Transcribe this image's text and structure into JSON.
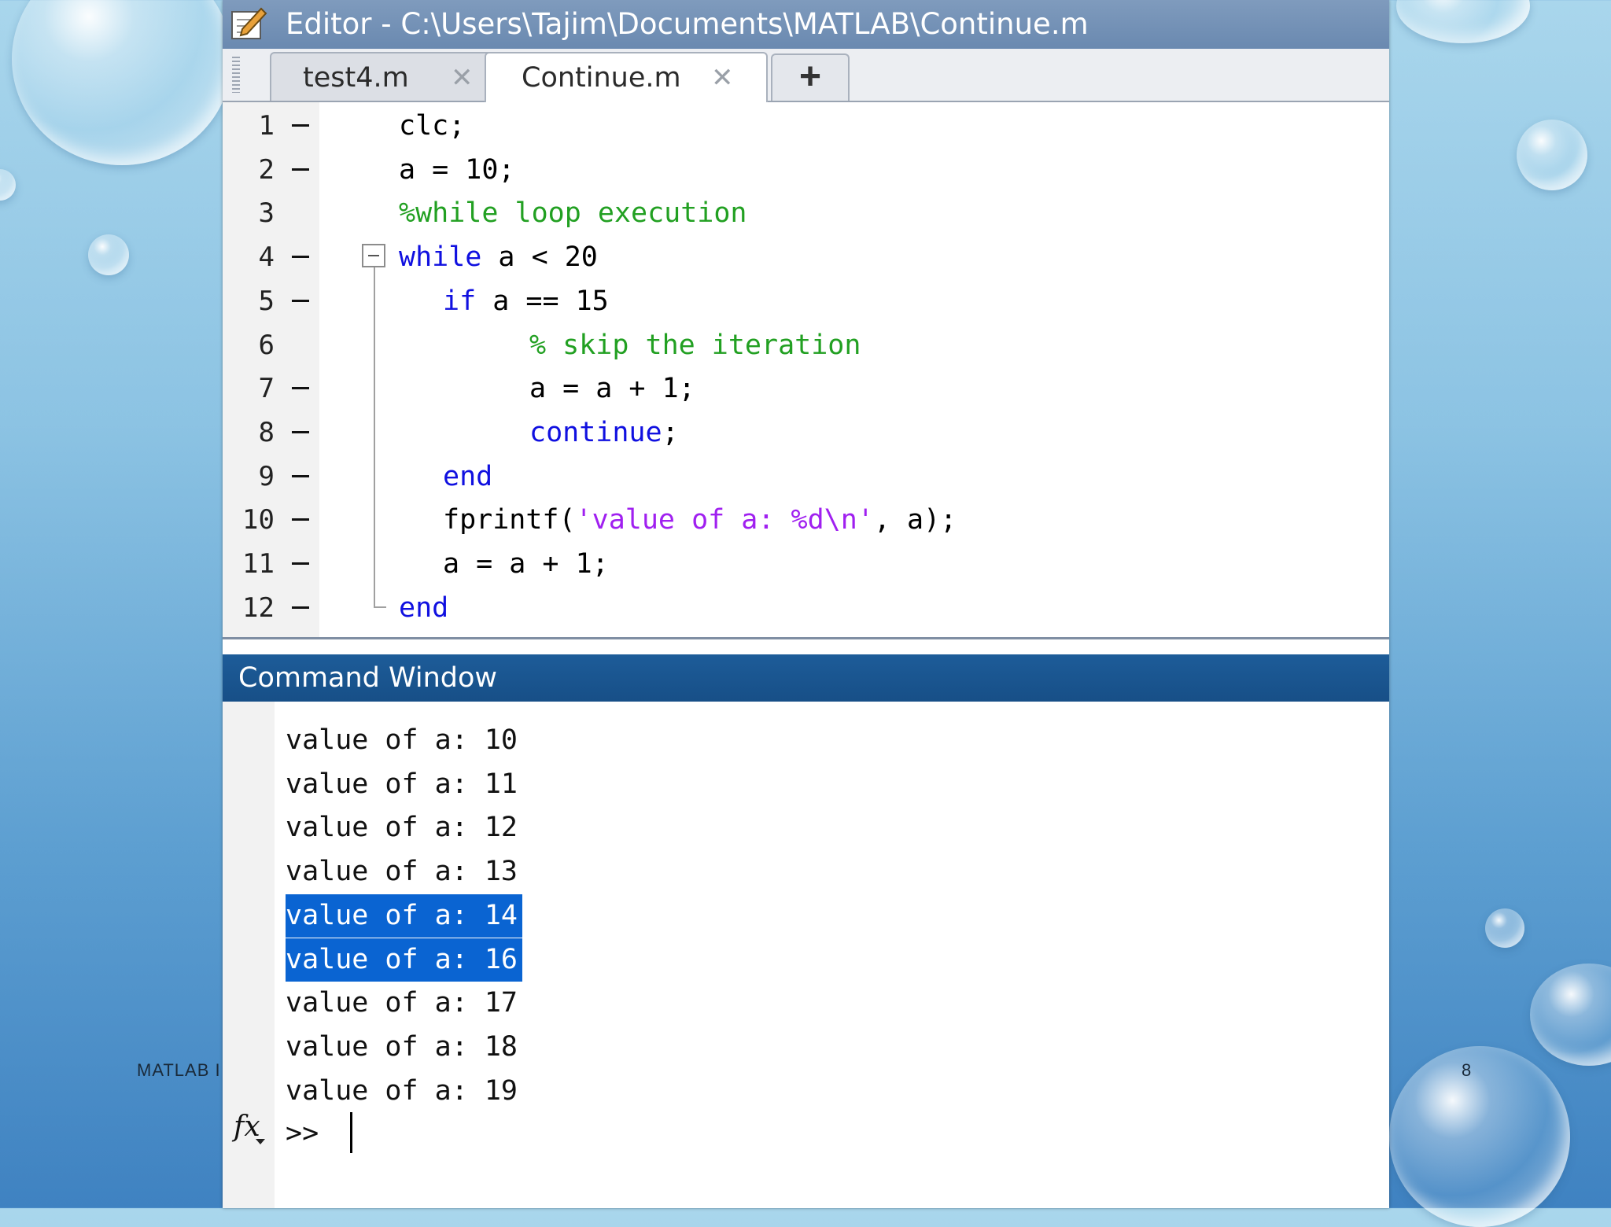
{
  "slide": {
    "footer_left": "MATLAB I",
    "page_number": "8"
  },
  "editor": {
    "title": "Editor - C:\\Users\\Tajim\\Documents\\MATLAB\\Continue.m",
    "tabs": [
      {
        "label": "test4.m",
        "close": "✕",
        "active": false
      },
      {
        "label": "Continue.m",
        "close": "✕",
        "active": true
      }
    ],
    "add_tab_label": "+",
    "lines": [
      {
        "num": "1",
        "marker": true
      },
      {
        "num": "2",
        "marker": true
      },
      {
        "num": "3",
        "marker": false
      },
      {
        "num": "4",
        "marker": true
      },
      {
        "num": "5",
        "marker": true
      },
      {
        "num": "6",
        "marker": false
      },
      {
        "num": "7",
        "marker": true
      },
      {
        "num": "8",
        "marker": true
      },
      {
        "num": "9",
        "marker": true
      },
      {
        "num": "10",
        "marker": true
      },
      {
        "num": "11",
        "marker": true
      },
      {
        "num": "12",
        "marker": true
      }
    ],
    "code": {
      "l1": "clc;",
      "l2": "a = 10;",
      "l3": "%while loop execution",
      "l4_kw": "while",
      "l4_rest": " a < 20",
      "l5_kw": "if",
      "l5_rest": " a == 15",
      "l6": "% skip the iteration",
      "l7": "a = a + 1;",
      "l8_kw": "continue",
      "l8_rest": ";",
      "l9_kw": "end",
      "l10_fn": "fprintf(",
      "l10_str": "'value of a: %d\\n'",
      "l10_rest": ", a);",
      "l11": "a = a + 1;",
      "l12_kw": "end"
    },
    "colors": {
      "keyword": "#1010e0",
      "comment": "#22a022",
      "string": "#a020f0"
    }
  },
  "command_window": {
    "title": "Command Window",
    "output": [
      {
        "text": "value of a: 10",
        "selected": false
      },
      {
        "text": "value of a: 11",
        "selected": false
      },
      {
        "text": "value of a: 12",
        "selected": false
      },
      {
        "text": "value of a: 13",
        "selected": false
      },
      {
        "text": "value of a: 14",
        "selected": true
      },
      {
        "text": "value of a: 16",
        "selected": true
      },
      {
        "text": "value of a: 17",
        "selected": false
      },
      {
        "text": "value of a: 18",
        "selected": false
      },
      {
        "text": "value of a: 19",
        "selected": false
      }
    ],
    "fx_label": "fx",
    "prompt": ">>",
    "selection_color": "#0a64d2"
  }
}
